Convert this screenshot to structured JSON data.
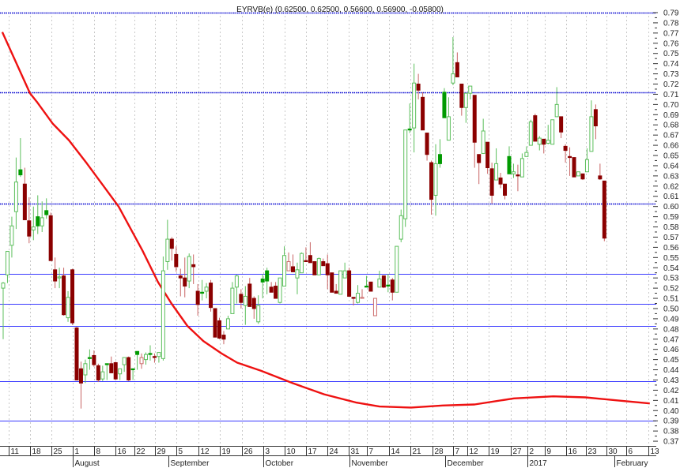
{
  "chart_data": {
    "type": "candlestick",
    "title": "EYRVB(e) (0.62500, 0.62500, 0.56600, 0.56900, -0.05800)",
    "ylim": [
      0.37,
      0.79
    ],
    "y_ticks": [
      "0.37",
      "0.38",
      "0.39",
      "0.40",
      "0.41",
      "0.42",
      "0.43",
      "0.44",
      "0.45",
      "0.46",
      "0.47",
      "0.48",
      "0.49",
      "0.50",
      "0.51",
      "0.52",
      "0.53",
      "0.54",
      "0.55",
      "0.56",
      "0.57",
      "0.58",
      "0.59",
      "0.60",
      "0.61",
      "0.62",
      "0.63",
      "0.64",
      "0.65",
      "0.66",
      "0.67",
      "0.68",
      "0.69",
      "0.70",
      "0.71",
      "0.72",
      "0.73",
      "0.74",
      "0.75",
      "0.76",
      "0.77",
      "0.78",
      "0.79"
    ],
    "x_ticks": [
      {
        "label": "11",
        "idx": 1.3
      },
      {
        "label": "18",
        "idx": 6.2
      },
      {
        "label": "25",
        "idx": 11.2
      },
      {
        "label": "1",
        "idx": 16.1
      },
      {
        "label": "8",
        "idx": 21.0
      },
      {
        "label": "16",
        "idx": 26.0
      },
      {
        "label": "22",
        "idx": 30.3
      },
      {
        "label": "29",
        "idx": 35.1
      },
      {
        "label": "5",
        "idx": 40.0
      },
      {
        "label": "12",
        "idx": 45.2
      },
      {
        "label": "19",
        "idx": 50.1
      },
      {
        "label": "26",
        "idx": 55.2
      },
      {
        "label": "3",
        "idx": 60.1
      },
      {
        "label": "10",
        "idx": 65.1
      },
      {
        "label": "17",
        "idx": 70.0
      },
      {
        "label": "24",
        "idx": 75.0
      },
      {
        "label": "31",
        "idx": 79.9
      },
      {
        "label": "7",
        "idx": 84.1
      },
      {
        "label": "14",
        "idx": 89.2
      },
      {
        "label": "21",
        "idx": 94.1
      },
      {
        "label": "28",
        "idx": 99.3
      },
      {
        "label": "7",
        "idx": 104.0
      },
      {
        "label": "12",
        "idx": 107.3
      },
      {
        "label": "19",
        "idx": 112.2
      },
      {
        "label": "27",
        "idx": 117.4
      },
      {
        "label": "2",
        "idx": 121.2
      },
      {
        "label": "9",
        "idx": 125.2
      },
      {
        "label": "16",
        "idx": 130.2
      },
      {
        "label": "23",
        "idx": 134.7
      },
      {
        "label": "30",
        "idx": 139.5
      },
      {
        "label": "6",
        "idx": 144.1
      },
      {
        "label": "13",
        "idx": 149.2
      }
    ],
    "months": [
      {
        "label": "August",
        "idx": 16.1
      },
      {
        "label": "September",
        "idx": 38.2
      },
      {
        "label": "October",
        "idx": 60.1
      },
      {
        "label": "November",
        "idx": 80.1
      },
      {
        "label": "December",
        "idx": 102.2
      },
      {
        "label": "2017",
        "idx": 121.2
      },
      {
        "label": "February",
        "idx": 141.3
      }
    ],
    "horizontal_lines": [
      {
        "value": 0.79,
        "style": "dotted"
      },
      {
        "value": 0.712,
        "style": "dotted"
      },
      {
        "value": 0.603,
        "style": "dotted"
      },
      {
        "value": 0.534,
        "style": "solid"
      },
      {
        "value": 0.505,
        "style": "solid"
      },
      {
        "value": 0.483,
        "style": "solid"
      },
      {
        "value": 0.429,
        "style": "solid"
      },
      {
        "value": 0.39,
        "style": "solid"
      }
    ],
    "ohlc_fields": [
      "open",
      "high",
      "low",
      "close"
    ],
    "candles": [
      [
        0.52,
        0.526,
        0.47,
        0.525
      ],
      [
        0.533,
        0.556,
        0.525,
        0.556
      ],
      [
        0.562,
        0.59,
        0.55,
        0.581
      ],
      [
        0.595,
        0.648,
        0.578,
        0.624
      ],
      [
        0.636,
        0.667,
        0.629,
        0.631
      ],
      [
        0.622,
        0.638,
        0.587,
        0.587
      ],
      [
        0.586,
        0.609,
        0.564,
        0.571
      ],
      [
        0.577,
        0.6,
        0.567,
        0.58
      ],
      [
        0.59,
        0.611,
        0.573,
        0.581
      ],
      [
        0.581,
        0.605,
        0.575,
        0.589
      ],
      [
        0.596,
        0.608,
        0.588,
        0.592
      ],
      [
        0.591,
        0.594,
        0.547,
        0.547
      ],
      [
        0.538,
        0.55,
        0.52,
        0.527
      ],
      [
        0.53,
        0.54,
        0.52,
        0.531
      ],
      [
        0.532,
        0.54,
        0.493,
        0.494
      ],
      [
        0.491,
        0.517,
        0.487,
        0.511
      ],
      [
        0.538,
        0.539,
        0.484,
        0.486
      ],
      [
        0.481,
        0.482,
        0.43,
        0.43
      ],
      [
        0.441,
        0.448,
        0.402,
        0.427
      ],
      [
        0.435,
        0.45,
        0.427,
        0.446
      ],
      [
        0.452,
        0.46,
        0.44,
        0.451
      ],
      [
        0.454,
        0.459,
        0.443,
        0.445
      ],
      [
        0.444,
        0.446,
        0.428,
        0.43
      ],
      [
        0.431,
        0.444,
        0.429,
        0.438
      ],
      [
        0.446,
        0.446,
        0.43,
        0.445
      ],
      [
        0.446,
        0.453,
        0.437,
        0.437
      ],
      [
        0.447,
        0.448,
        0.43,
        0.431
      ],
      [
        0.436,
        0.441,
        0.43,
        0.441
      ],
      [
        0.445,
        0.452,
        0.438,
        0.452
      ],
      [
        0.452,
        0.453,
        0.429,
        0.43
      ],
      [
        0.441,
        0.441,
        0.43,
        0.44
      ],
      [
        0.458,
        0.458,
        0.44,
        0.455
      ],
      [
        0.446,
        0.456,
        0.441,
        0.452
      ],
      [
        0.45,
        0.457,
        0.445,
        0.455
      ],
      [
        0.456,
        0.464,
        0.449,
        0.455
      ],
      [
        0.453,
        0.456,
        0.447,
        0.452
      ],
      [
        0.453,
        0.457,
        0.447,
        0.457
      ],
      [
        0.451,
        0.551,
        0.449,
        0.537
      ],
      [
        0.546,
        0.587,
        0.538,
        0.568
      ],
      [
        0.568,
        0.57,
        0.547,
        0.559
      ],
      [
        0.553,
        0.561,
        0.536,
        0.541
      ],
      [
        0.532,
        0.539,
        0.512,
        0.53
      ],
      [
        0.53,
        0.55,
        0.511,
        0.522
      ],
      [
        0.527,
        0.554,
        0.52,
        0.551
      ],
      [
        0.543,
        0.553,
        0.524,
        0.541
      ],
      [
        0.517,
        0.524,
        0.493,
        0.504
      ],
      [
        0.516,
        0.528,
        0.508,
        0.515
      ],
      [
        0.517,
        0.525,
        0.51,
        0.521
      ],
      [
        0.525,
        0.528,
        0.497,
        0.501
      ],
      [
        0.5,
        0.5,
        0.472,
        0.472
      ],
      [
        0.488,
        0.491,
        0.47,
        0.471
      ],
      [
        0.474,
        0.478,
        0.465,
        0.47
      ],
      [
        0.48,
        0.493,
        0.48,
        0.49
      ],
      [
        0.495,
        0.526,
        0.495,
        0.52
      ],
      [
        0.521,
        0.533,
        0.505,
        0.532
      ],
      [
        0.514,
        0.519,
        0.5,
        0.506
      ],
      [
        0.503,
        0.522,
        0.484,
        0.512
      ],
      [
        0.524,
        0.53,
        0.502,
        0.502
      ],
      [
        0.51,
        0.512,
        0.49,
        0.5
      ],
      [
        0.487,
        0.513,
        0.485,
        0.503
      ],
      [
        0.529,
        0.534,
        0.51,
        0.526
      ],
      [
        0.537,
        0.54,
        0.514,
        0.527
      ],
      [
        0.521,
        0.526,
        0.516,
        0.516
      ],
      [
        0.522,
        0.526,
        0.51,
        0.51
      ],
      [
        0.506,
        0.53,
        0.505,
        0.53
      ],
      [
        0.522,
        0.561,
        0.522,
        0.552
      ],
      [
        0.537,
        0.555,
        0.537,
        0.546
      ],
      [
        0.541,
        0.553,
        0.536,
        0.536
      ],
      [
        0.53,
        0.545,
        0.514,
        0.538
      ],
      [
        0.535,
        0.555,
        0.535,
        0.554
      ],
      [
        0.547,
        0.56,
        0.546,
        0.546
      ],
      [
        0.552,
        0.565,
        0.545,
        0.545
      ],
      [
        0.546,
        0.546,
        0.533,
        0.533
      ],
      [
        0.533,
        0.55,
        0.533,
        0.549
      ],
      [
        0.546,
        0.549,
        0.542,
        0.542
      ],
      [
        0.544,
        0.553,
        0.519,
        0.533
      ],
      [
        0.535,
        0.535,
        0.516,
        0.516
      ],
      [
        0.517,
        0.524,
        0.515,
        0.515
      ],
      [
        0.514,
        0.537,
        0.514,
        0.537
      ],
      [
        0.53,
        0.545,
        0.53,
        0.537
      ],
      [
        0.537,
        0.54,
        0.512,
        0.512
      ],
      [
        0.511,
        0.511,
        0.503,
        0.51
      ],
      [
        0.506,
        0.523,
        0.505,
        0.515
      ],
      [
        0.51,
        0.519,
        0.51,
        0.511
      ],
      [
        0.522,
        0.532,
        0.521,
        0.521
      ],
      [
        0.526,
        0.526,
        0.517,
        0.517
      ],
      [
        0.493,
        0.51,
        0.493,
        0.51
      ],
      [
        0.521,
        0.537,
        0.521,
        0.529
      ],
      [
        0.532,
        0.532,
        0.52,
        0.521
      ],
      [
        0.523,
        0.534,
        0.516,
        0.522
      ],
      [
        0.528,
        0.53,
        0.508,
        0.516
      ],
      [
        0.516,
        0.561,
        0.516,
        0.561
      ],
      [
        0.568,
        0.597,
        0.565,
        0.591
      ],
      [
        0.588,
        0.675,
        0.58,
        0.675
      ],
      [
        0.676,
        0.701,
        0.672,
        0.675
      ],
      [
        0.677,
        0.74,
        0.653,
        0.721
      ],
      [
        0.72,
        0.73,
        0.705,
        0.714
      ],
      [
        0.707,
        0.712,
        0.675,
        0.675
      ],
      [
        0.672,
        0.672,
        0.645,
        0.651
      ],
      [
        0.643,
        0.645,
        0.592,
        0.607
      ],
      [
        0.611,
        0.661,
        0.591,
        0.642
      ],
      [
        0.651,
        0.666,
        0.638,
        0.642
      ],
      [
        0.712,
        0.716,
        0.687,
        0.687
      ],
      [
        0.665,
        0.707,
        0.665,
        0.688
      ],
      [
        0.721,
        0.766,
        0.719,
        0.73
      ],
      [
        0.741,
        0.751,
        0.727,
        0.727
      ],
      [
        0.72,
        0.72,
        0.689,
        0.697
      ],
      [
        0.697,
        0.711,
        0.682,
        0.711
      ],
      [
        0.711,
        0.718,
        0.705,
        0.718
      ],
      [
        0.709,
        0.709,
        0.638,
        0.663
      ],
      [
        0.651,
        0.651,
        0.622,
        0.643
      ],
      [
        0.652,
        0.686,
        0.652,
        0.674
      ],
      [
        0.663,
        0.663,
        0.632,
        0.638
      ],
      [
        0.637,
        0.643,
        0.603,
        0.611
      ],
      [
        0.626,
        0.657,
        0.626,
        0.642
      ],
      [
        0.628,
        0.633,
        0.618,
        0.622
      ],
      [
        0.622,
        0.622,
        0.607,
        0.611
      ],
      [
        0.649,
        0.659,
        0.632,
        0.632
      ],
      [
        0.632,
        0.642,
        0.628,
        0.634
      ],
      [
        0.631,
        0.641,
        0.615,
        0.63
      ],
      [
        0.629,
        0.652,
        0.629,
        0.647
      ],
      [
        0.649,
        0.659,
        0.649,
        0.653
      ],
      [
        0.66,
        0.685,
        0.66,
        0.683
      ],
      [
        0.689,
        0.691,
        0.664,
        0.664
      ],
      [
        0.661,
        0.669,
        0.655,
        0.667
      ],
      [
        0.666,
        0.666,
        0.652,
        0.661
      ],
      [
        0.662,
        0.68,
        0.661,
        0.665
      ],
      [
        0.661,
        0.685,
        0.661,
        0.685
      ],
      [
        0.688,
        0.717,
        0.688,
        0.7
      ],
      [
        0.688,
        0.688,
        0.667,
        0.673
      ],
      [
        0.659,
        0.661,
        0.643,
        0.655
      ],
      [
        0.649,
        0.658,
        0.63,
        0.648
      ],
      [
        0.648,
        0.648,
        0.629,
        0.629
      ],
      [
        0.63,
        0.634,
        0.63,
        0.634
      ],
      [
        0.632,
        0.632,
        0.626,
        0.627
      ],
      [
        0.634,
        0.657,
        0.634,
        0.646
      ],
      [
        0.654,
        0.704,
        0.654,
        0.688
      ],
      [
        0.695,
        0.7,
        0.666,
        0.679
      ],
      [
        0.63,
        0.642,
        0.626,
        0.627
      ],
      [
        0.625,
        0.625,
        0.566,
        0.569
      ]
    ],
    "moving_average": [
      [
        -0.2,
        0.771
      ],
      [
        6.2,
        0.711
      ],
      [
        7.9,
        0.702
      ],
      [
        11.5,
        0.681
      ],
      [
        15.2,
        0.665
      ],
      [
        19.4,
        0.642
      ],
      [
        26.7,
        0.6
      ],
      [
        32.2,
        0.557
      ],
      [
        35.8,
        0.526
      ],
      [
        38.9,
        0.505
      ],
      [
        42.6,
        0.483
      ],
      [
        46.3,
        0.468
      ],
      [
        50.5,
        0.456
      ],
      [
        54.1,
        0.447
      ],
      [
        59.6,
        0.439
      ],
      [
        66.9,
        0.427
      ],
      [
        74.2,
        0.416
      ],
      [
        81.5,
        0.408
      ],
      [
        87.0,
        0.404
      ],
      [
        94.3,
        0.403
      ],
      [
        101.6,
        0.405
      ],
      [
        109.0,
        0.406
      ],
      [
        118.1,
        0.412
      ],
      [
        127.2,
        0.414
      ],
      [
        134.6,
        0.413
      ],
      [
        141.9,
        0.41
      ],
      [
        149.5,
        0.407
      ]
    ],
    "colors": {
      "up_hollow": "#5cbf5c",
      "up_filled": "#009a00",
      "down_filled": "#8b0000",
      "down_hollow": "#cc6a6a",
      "down_wick": "#c86464",
      "ma": "#ee1111",
      "line_solid": "#3a3aff",
      "line_dotted": "#0000d0",
      "grid": "#c8c8c8"
    }
  }
}
